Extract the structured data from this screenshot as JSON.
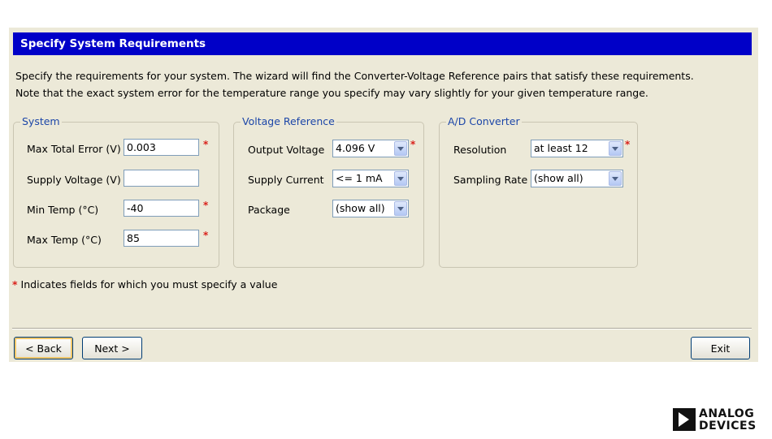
{
  "title": "Specify System Requirements",
  "description": {
    "line1": "Specify the requirements for your system. The wizard will find the Converter-Voltage Reference pairs that satisfy these requirements.",
    "line2": "Note that the exact system error for the temperature range you specify may vary slightly for your given temperature range."
  },
  "system": {
    "legend": "System",
    "max_total_error": {
      "label": "Max Total Error (V)",
      "value": "0.003",
      "required": true
    },
    "supply_voltage": {
      "label": "Supply Voltage (V)",
      "value": "",
      "required": false
    },
    "min_temp": {
      "label": "Min Temp (°C)",
      "value": "-40",
      "required": true
    },
    "max_temp": {
      "label": "Max Temp (°C)",
      "value": "85",
      "required": true
    }
  },
  "voltage_reference": {
    "legend": "Voltage Reference",
    "output_voltage": {
      "label": "Output Voltage",
      "value": "4.096 V",
      "required": true
    },
    "supply_current": {
      "label": "Supply Current",
      "value": "<= 1 mA"
    },
    "package": {
      "label": "Package",
      "value": "(show all)"
    }
  },
  "ad_converter": {
    "legend": "A/D Converter",
    "resolution": {
      "label": "Resolution",
      "value": "at least 12",
      "required": true
    },
    "sampling_rate": {
      "label": "Sampling Rate",
      "value": "(show all)"
    }
  },
  "required_marker": "*",
  "footnote": "Indicates fields for which you must specify a value",
  "buttons": {
    "back": "< Back",
    "next": "Next >",
    "exit": "Exit"
  },
  "logo": {
    "line1": "ANALOG",
    "line2": "DEVICES"
  },
  "colors": {
    "title_bar": "#0000c8",
    "legend_text": "#1c46a8",
    "required": "#d9201a",
    "panel": "#ece9d8"
  }
}
